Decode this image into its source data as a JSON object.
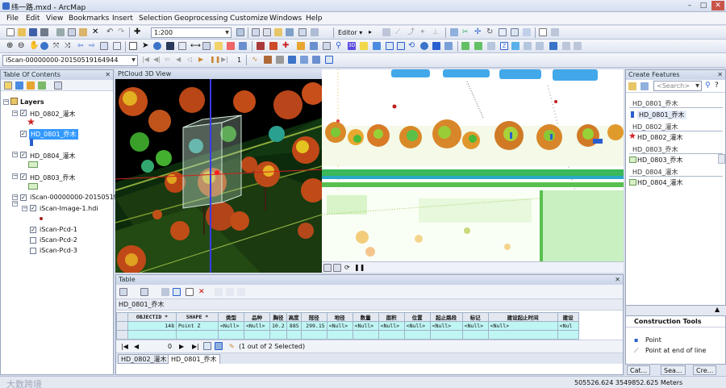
{
  "title": "纬一路.mxd - ArcMap",
  "menu": [
    "File",
    "Edit",
    "View",
    "Bookmarks",
    "Insert",
    "Selection",
    "Geoprocessing",
    "Customize",
    "Windows",
    "Help"
  ],
  "toolbar": {
    "scale": "1:200",
    "editor_label": "Editor ▾",
    "scan_combo": "iScan-00000000-20150519164944",
    "frame_number": "1"
  },
  "toc": {
    "title": "Table Of Contents",
    "root": "Layers",
    "layers": [
      {
        "name": "HD_0802_灌木",
        "checked": true
      },
      {
        "name": "HD_0801_乔木",
        "checked": true,
        "selected": true
      },
      {
        "name": "HD_0804_灌木",
        "checked": true
      },
      {
        "name": "HD_0803_乔木",
        "checked": true
      },
      {
        "name": "iScan-00000000-20150519",
        "checked": true
      }
    ],
    "image_layer": "iScan-Image-1.hdi",
    "pcd": [
      {
        "name": "iScan-Pcd-1",
        "checked": true
      },
      {
        "name": "iScan-Pcd-2",
        "checked": false
      },
      {
        "name": "iScan-Pcd-3",
        "checked": false
      }
    ]
  },
  "view3d": {
    "title": "PtCloud 3D View"
  },
  "table": {
    "title": "Table",
    "layer_tab": "HD_0801_乔木",
    "columns": [
      "OBJECTID *",
      "SHAPE *",
      "类型",
      "品种",
      "胸径",
      "高度",
      "冠径",
      "地径",
      "数量",
      "面积",
      "位置",
      "起止路段",
      "标记",
      "建设起止时间",
      "建设"
    ],
    "row": [
      "148",
      "Point Z",
      "<Null>",
      "<Null>",
      "10.2",
      "885",
      "299.15",
      "<Null>",
      "<Null>",
      "<Null>",
      "<Null>",
      "<Null>",
      "<Null>",
      "<Null>",
      "<Nul"
    ],
    "record": "0",
    "selection_text": "(1 out of 2 Selected)",
    "bottom_tabs": [
      "HD_0802_灌木",
      "HD_0801_乔木"
    ]
  },
  "create_features": {
    "title": "Create Features",
    "search_placeholder": "<Search>",
    "groups": [
      {
        "group": "HD_0801_乔木",
        "item": "HD_0801_乔木",
        "symbol": "pin"
      },
      {
        "group": "HD_0802_灌木",
        "item": "HD_0802_灌木",
        "symbol": "star"
      },
      {
        "group": "HD_0803_乔木",
        "item": "HD_0803_乔木",
        "symbol": "square"
      },
      {
        "group": "HD_0804_灌木",
        "item": "HD_0804_灌木",
        "symbol": "square"
      }
    ]
  },
  "construction_tools": {
    "title": "Construction Tools",
    "items": [
      "Point",
      "Point at end of line"
    ]
  },
  "right_tabs": [
    "Cat...",
    "Sea...",
    "Cre..."
  ],
  "status": {
    "coords": "505526.624  3549852.625 Meters"
  },
  "watermark": "大数跨境",
  "colors": {
    "selection": "#3399ff",
    "star": "#d02020",
    "table_row": "#bff5f3",
    "pin": "#2a5fcf",
    "layer_swatch": "#d8f0c8"
  }
}
